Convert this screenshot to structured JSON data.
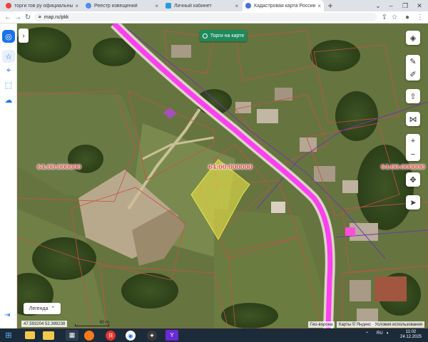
{
  "browser": {
    "tabs": [
      {
        "label": "торги гов ру официальный сай",
        "favicon_color": "#e8453c",
        "active": false
      },
      {
        "label": "Реестр извещений",
        "favicon_color": "#4d8ee8",
        "active": false
      },
      {
        "label": "Личный кабинет",
        "favicon_color": "#2a9bd8",
        "active": false
      },
      {
        "label": "Кадастровая карта России онл",
        "favicon_color": "#4a6fd8",
        "active": true
      }
    ],
    "new_tab": "+",
    "address": "map.ru/pkk"
  },
  "map": {
    "torgi_button": "Торги на карте",
    "cadastral_labels": [
      "64:00:000000",
      "64:00:000000",
      "64:00:000000"
    ],
    "legend_button": "Легенда",
    "coords": "47.593204 52.389238",
    "scale": "60 m",
    "attribution_left": "Гео-ворона",
    "attribution_right": "Карты © Яндекс · Условия использования",
    "accent_color": "#1f8a5b",
    "road_color": "#ff3ff0",
    "parcel_fill": "#e8e44a"
  },
  "taskbar": {
    "lang": "RU",
    "time": "11:02",
    "date": "24.12.2025"
  }
}
